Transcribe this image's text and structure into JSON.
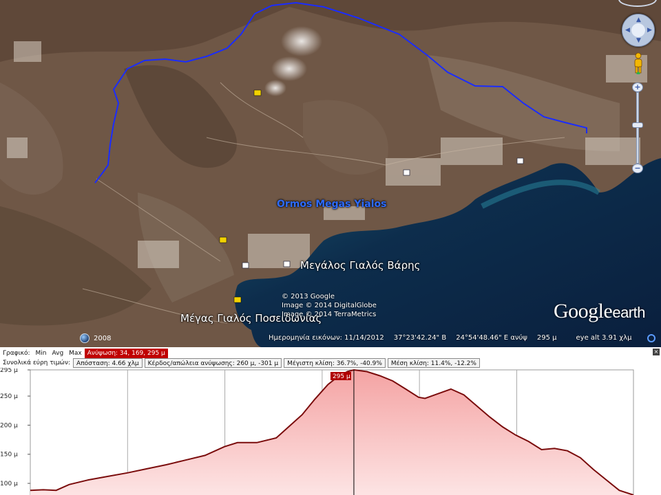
{
  "map": {
    "places": {
      "ormos": "Ormos Megas Yialos",
      "megalos": "Μεγάλος Γιαλός Βάρης",
      "megas": "Μέγας Γιαλός Ποσειδωνίας"
    },
    "copyright": [
      "© 2013 Google",
      "Image © 2014 DigitalGlobe",
      "Image © 2014 TerraMetrics"
    ],
    "logo_google": "Google",
    "logo_earth": "earth",
    "year": "2008",
    "status": {
      "imagery_date": "Ημερομηνία εικόνων: 11/14/2012",
      "lat": "37°23'42.24\" Β",
      "lon": "24°54'48.46\" Ε",
      "elev_label": "ανύψ",
      "elev_value": "295 μ",
      "eye_alt_label": "eye alt",
      "eye_alt_value": "3.91 χλμ"
    },
    "colors": {
      "track": "#1a2cff",
      "ocean": "#0c2a4a",
      "land": "#6b5443"
    }
  },
  "profile": {
    "row1": {
      "graph_label": "Γραφικό:",
      "min": "Min",
      "avg": "Avg",
      "max": "Max",
      "elevation": "Ανύψωση: 34, 169, 295 μ"
    },
    "row2": {
      "totals_label": "Συνολικά εύρη τιμών:",
      "distance": "Απόσταση: 4.66 χλμ",
      "gain_loss": "Κέρδος/απώλεια ανύψωσης: 260 μ, -301 μ",
      "max_slope": "Μέγιστη κλίση: 36.7%, -40.9%",
      "avg_slope": "Μέση κλίση: 11.4%, -12.2%"
    },
    "close": "×"
  },
  "chart_data": {
    "type": "area",
    "ylabel": "",
    "yticks": [
      "295 μ",
      "250 μ",
      "200 μ",
      "150 μ",
      "100 μ"
    ],
    "ytick_values": [
      295,
      250,
      200,
      150,
      100
    ],
    "ylim": [
      80,
      295
    ],
    "xlim": [
      0,
      4.66
    ],
    "tooltip": "295 μ",
    "cursor_x": 2.5,
    "series": [
      {
        "values": [
          [
            0,
            88
          ],
          [
            0.1,
            89
          ],
          [
            0.2,
            88
          ],
          [
            0.3,
            98
          ],
          [
            0.45,
            106
          ],
          [
            0.6,
            112
          ],
          [
            0.75,
            118
          ],
          [
            0.9,
            125
          ],
          [
            1.05,
            132
          ],
          [
            1.2,
            140
          ],
          [
            1.35,
            148
          ],
          [
            1.5,
            163
          ],
          [
            1.6,
            170
          ],
          [
            1.75,
            170
          ],
          [
            1.9,
            178
          ],
          [
            2.0,
            198
          ],
          [
            2.1,
            218
          ],
          [
            2.2,
            245
          ],
          [
            2.3,
            270
          ],
          [
            2.38,
            284
          ],
          [
            2.45,
            292
          ],
          [
            2.5,
            295
          ],
          [
            2.6,
            292
          ],
          [
            2.7,
            285
          ],
          [
            2.8,
            276
          ],
          [
            2.9,
            262
          ],
          [
            3.0,
            248
          ],
          [
            3.05,
            246
          ],
          [
            3.15,
            254
          ],
          [
            3.25,
            262
          ],
          [
            3.35,
            252
          ],
          [
            3.45,
            233
          ],
          [
            3.55,
            214
          ],
          [
            3.65,
            197
          ],
          [
            3.75,
            183
          ],
          [
            3.85,
            172
          ],
          [
            3.95,
            158
          ],
          [
            4.05,
            160
          ],
          [
            4.15,
            156
          ],
          [
            4.25,
            144
          ],
          [
            4.35,
            124
          ],
          [
            4.45,
            106
          ],
          [
            4.55,
            88
          ],
          [
            4.66,
            80
          ]
        ]
      }
    ]
  }
}
